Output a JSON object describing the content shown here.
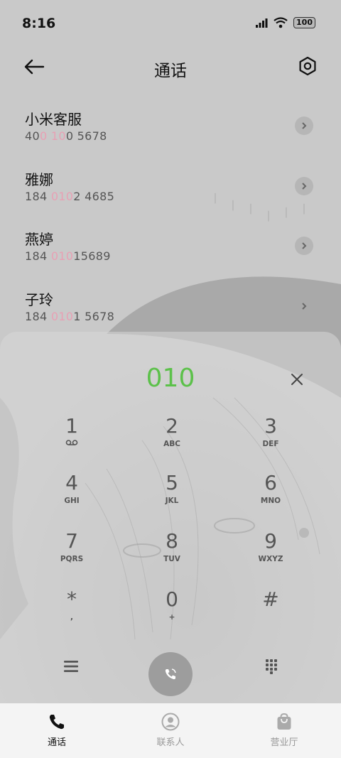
{
  "status": {
    "time": "8:16",
    "battery": "100"
  },
  "header": {
    "title": "通话"
  },
  "contacts": [
    {
      "name": "小米客服",
      "number_parts": [
        "40",
        "0",
        " ",
        "10",
        "0 5678"
      ]
    },
    {
      "name": "雅娜",
      "number_parts": [
        "184 ",
        "010",
        "2 4685"
      ]
    },
    {
      "name": "燕婷",
      "number_parts": [
        "184 ",
        "010",
        "15689"
      ]
    },
    {
      "name": "子玲",
      "number_parts": [
        "184 ",
        "010",
        "1 5678"
      ]
    }
  ],
  "dialpad": {
    "dialed_number": "010",
    "keys": [
      {
        "digit": "1",
        "letters": ""
      },
      {
        "digit": "2",
        "letters": "ABC"
      },
      {
        "digit": "3",
        "letters": "DEF"
      },
      {
        "digit": "4",
        "letters": "GHI"
      },
      {
        "digit": "5",
        "letters": "JKL"
      },
      {
        "digit": "6",
        "letters": "MNO"
      },
      {
        "digit": "7",
        "letters": "PQRS"
      },
      {
        "digit": "8",
        "letters": "TUV"
      },
      {
        "digit": "9",
        "letters": "WXYZ"
      },
      {
        "digit": "*",
        "letters": ","
      },
      {
        "digit": "0",
        "letters": "+"
      },
      {
        "digit": "#",
        "letters": ""
      }
    ]
  },
  "bottom_nav": [
    {
      "label": "通话",
      "icon": "phone-icon",
      "active": true
    },
    {
      "label": "联系人",
      "icon": "person-icon",
      "active": false
    },
    {
      "label": "营业厅",
      "icon": "bag-icon",
      "active": false
    }
  ],
  "colors": {
    "accent_green": "#5cc14a",
    "match_highlight": "#e8a0b4"
  }
}
